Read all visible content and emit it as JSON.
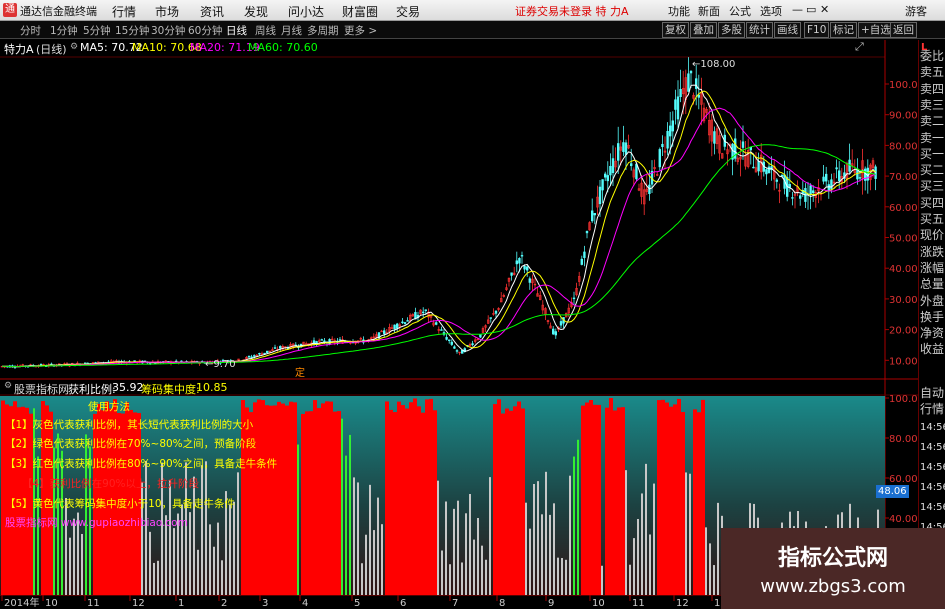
{
  "titlebar": {
    "app_title": "通达信金融终端",
    "logo": "通",
    "menu": [
      "行情",
      "市场",
      "资讯",
      "发现",
      "问小达",
      "财富圈",
      "交易"
    ],
    "notice": "证券交易未登录  特 力A",
    "right": [
      "功能",
      "新面",
      "公式",
      "选项"
    ],
    "guest": "游客"
  },
  "toolbar": {
    "periods": [
      "分时",
      "1分钟",
      "5分钟",
      "15分钟",
      "30分钟",
      "60分钟",
      "日线",
      "周线",
      "月线",
      "多周期",
      "更多 >"
    ],
    "active_period": "日线",
    "right_buttons": [
      "复权",
      "叠加",
      "多股",
      "统计",
      "画线",
      "F10",
      "标记",
      "+自选",
      "返回"
    ]
  },
  "chart_header": {
    "stock": "特力A",
    "period": "(日线)",
    "ma": [
      {
        "label": "MA5: 70.72",
        "color": "#ffffff"
      },
      {
        "label": "MA10: 70.68",
        "color": "#ffff00"
      },
      {
        "label": "MA20: 71.19",
        "color": "#ff00ff"
      },
      {
        "label": "MA60: 70.60",
        "color": "#00ff00"
      }
    ]
  },
  "price_chart": {
    "y_ticks": [
      "100.0",
      "90.00",
      "80.00",
      "70.00",
      "60.00",
      "50.00",
      "40.00",
      "30.00",
      "20.00",
      "10.00"
    ],
    "high_label": "108.00",
    "low_label": "9.70",
    "marker": "定"
  },
  "indicator": {
    "source": "股票指标网",
    "label": "获利比例:",
    "value": "35.92",
    "label2": "筹码集中度:",
    "value2": "10.85",
    "y_ticks": [
      "100.0",
      "80.00",
      "60.00",
      "40.00"
    ],
    "current_value": "48.06",
    "notes": [
      {
        "text": "使用方法",
        "color": "#ffff00"
      },
      {
        "text": "【1】灰色代表获利比例，其长短代表获利比例的大小",
        "color": "#ffff00"
      },
      {
        "text": "【2】绿色代表获利比例在70%~80%之间，预备阶段",
        "color": "#ffff00"
      },
      {
        "text": "【3】红色代表获利比例在80%~90%之间，具备走牛条件",
        "color": "#ffff00"
      },
      {
        "text": "【4】获利比例在90%以上，拉升阶段",
        "color": "#ff2020"
      },
      {
        "text": "【5】黄色代表筹码集中度小于10，具备走牛条件",
        "color": "#ffff00"
      },
      {
        "text": "股票指标网 www.gupiaozhibiao.com",
        "color": "#ff44ff"
      }
    ]
  },
  "time_axis": [
    "2014年",
    "10",
    "11",
    "12",
    "1",
    "2",
    "3",
    "4",
    "5",
    "6",
    "7",
    "8",
    "9",
    "10",
    "11",
    "12",
    "1"
  ],
  "sidepanel": {
    "quote_items": [
      "委比",
      "卖五",
      "卖四",
      "卖三",
      "卖二",
      "卖一",
      "买一",
      "买二",
      "买三",
      "买四",
      "买五",
      "现价",
      "涨跌",
      "涨幅",
      "总量",
      "外盘",
      "换手",
      "净资",
      "收益"
    ],
    "bottom_items": [
      "自动",
      "行情"
    ],
    "times": [
      "14:56",
      "14:56",
      "14:56",
      "14:56",
      "14:56",
      "14:56",
      "14:56",
      "14:56",
      "14:56"
    ],
    "corner": "L"
  },
  "watermark": {
    "line1": "指标公式网",
    "line2": "www.zbgs3.com"
  }
}
